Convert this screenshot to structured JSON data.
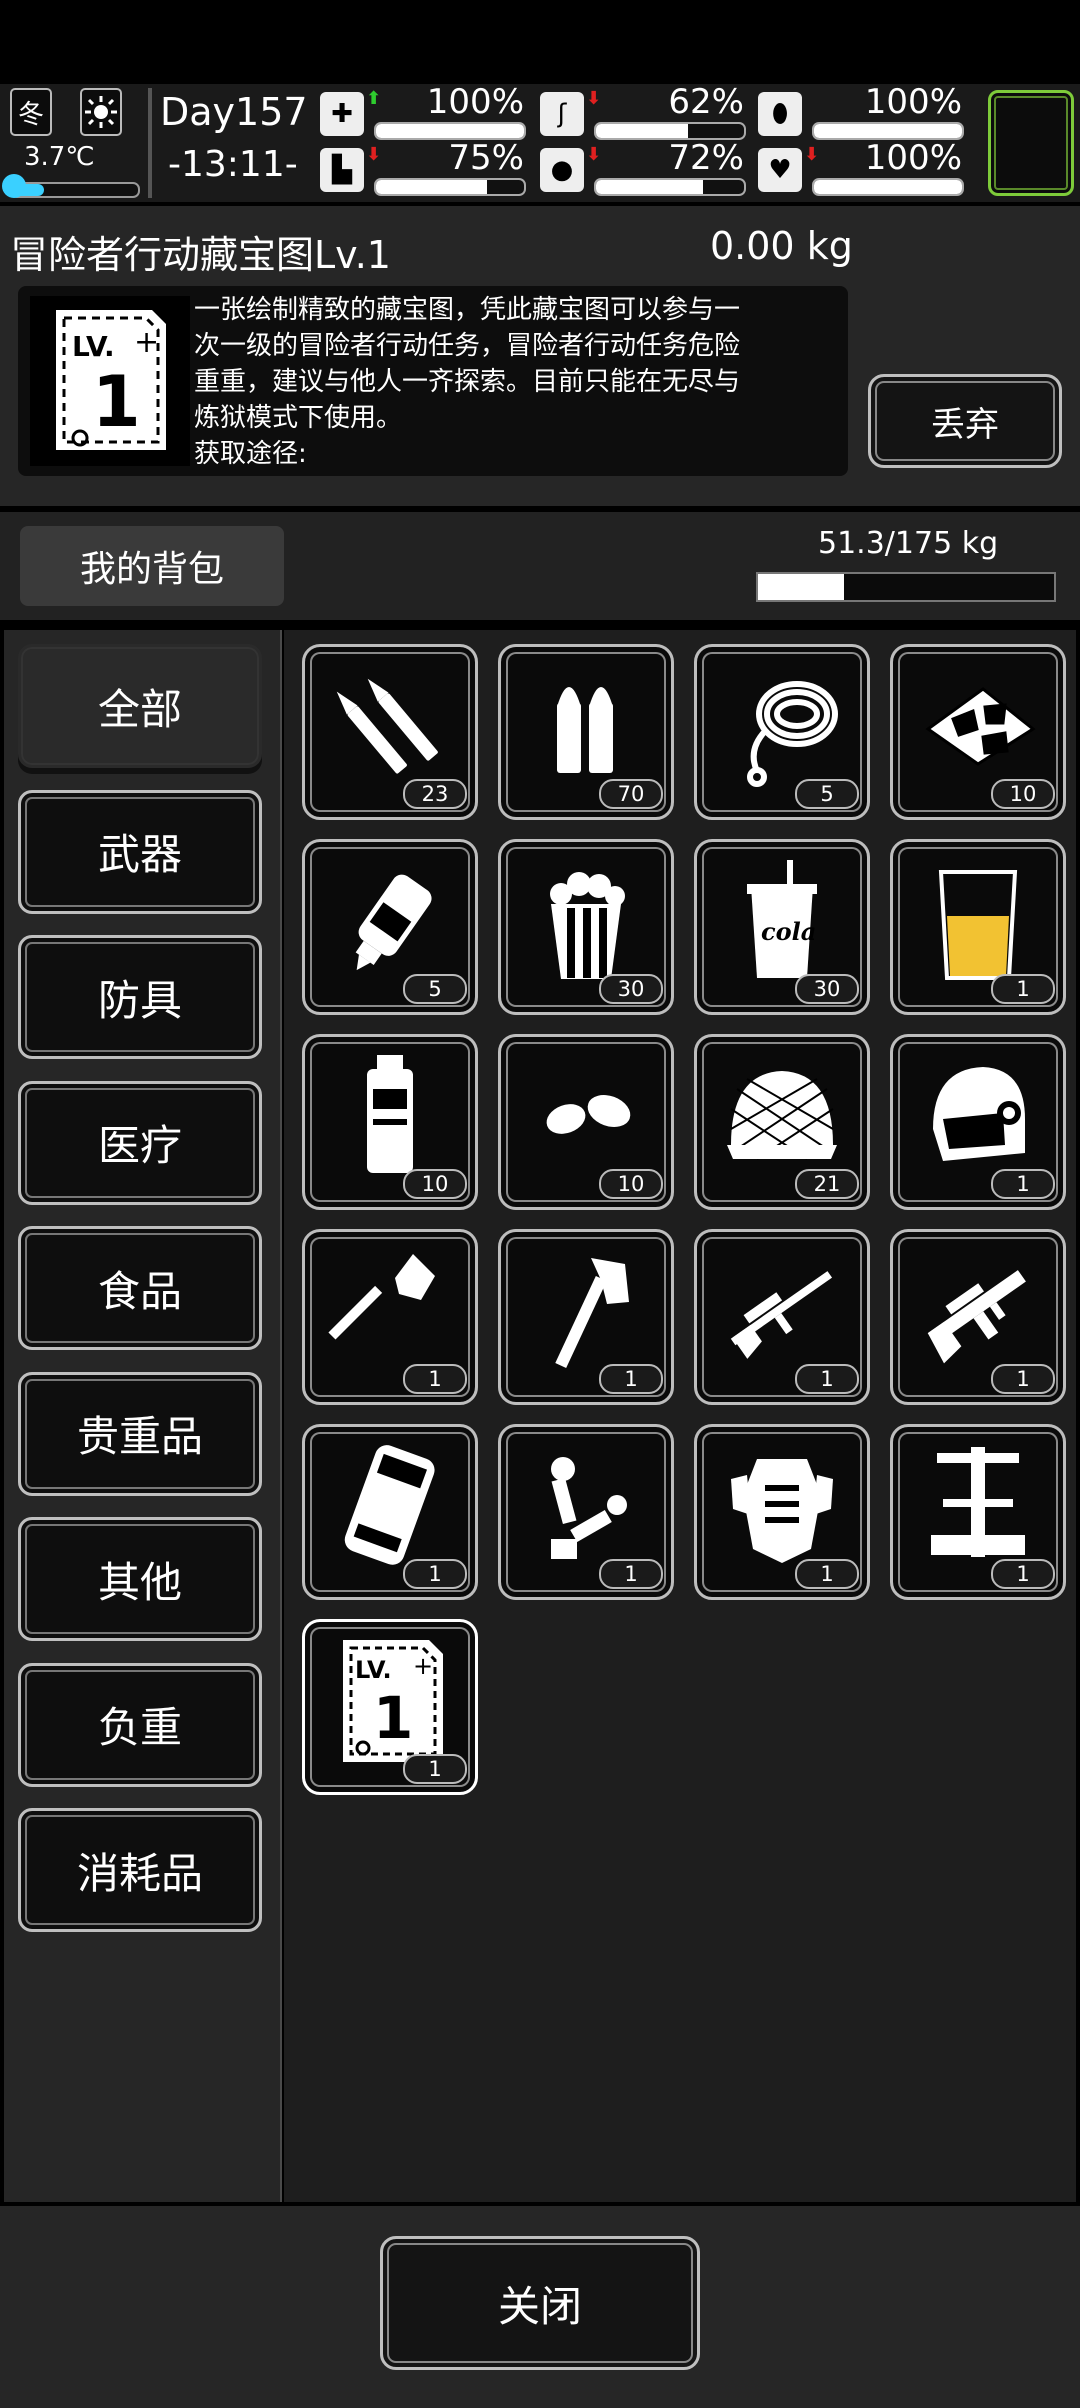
{
  "status": {
    "season": "冬",
    "weather_icon": "sun-icon",
    "temperature": "3.7℃",
    "temperature_level": 0.25,
    "day": "Day157",
    "time": "-13:11-",
    "stats": [
      {
        "name": "health",
        "icon": "medkit-icon",
        "trend": "up",
        "value": "100%",
        "level": 1.0
      },
      {
        "name": "hunger",
        "icon": "stomach-icon",
        "trend": "down",
        "value": "62%",
        "level": 0.62
      },
      {
        "name": "armor",
        "icon": "armor-icon",
        "trend": "none",
        "value": "100%",
        "level": 1.0
      },
      {
        "name": "stamina",
        "icon": "leg-icon",
        "trend": "down",
        "value": "75%",
        "level": 0.75
      },
      {
        "name": "thirst",
        "icon": "water-drop-icon",
        "trend": "down",
        "value": "72%",
        "level": 0.72
      },
      {
        "name": "mood",
        "icon": "heart-icon",
        "trend": "down",
        "value": "100%",
        "level": 1.0
      }
    ],
    "colors": {
      "up": "#2ecc2e",
      "down": "#e02020",
      "equip_border": "#7ecb3a"
    }
  },
  "item_detail": {
    "name": "冒险者行动藏宝图Lv.1",
    "weight": "0.00 kg",
    "icon_text_lv": "LV.",
    "icon_text_num": "1",
    "description_lines": [
      "一张绘制精致的藏宝图，凭此藏宝图可以参与一",
      "次一级的冒险者行动任务，冒险者行动任务危险",
      "重重，建议与他人一齐探索。目前只能在无尽与",
      "炼狱模式下使用。",
      "获取途径:"
    ],
    "discard_label": "丢弃"
  },
  "backpack": {
    "title": "我的背包",
    "weight": "51.3/175 kg",
    "load_fraction": 0.29
  },
  "categories": [
    "全部",
    "武器",
    "防具",
    "医疗",
    "食品",
    "贵重品",
    "其他",
    "负重",
    "消耗品"
  ],
  "items": [
    {
      "icon": "bullets-rifle-icon",
      "count": "23"
    },
    {
      "icon": "bullets-pistol-icon",
      "count": "70"
    },
    {
      "icon": "rope-icon",
      "count": "5"
    },
    {
      "icon": "cloth-scraps-icon",
      "count": "10"
    },
    {
      "icon": "glue-bottle-icon",
      "count": "5"
    },
    {
      "icon": "popcorn-icon",
      "count": "30"
    },
    {
      "icon": "cola-icon",
      "count": "30",
      "text": "cola"
    },
    {
      "icon": "juice-cup-icon",
      "count": "1"
    },
    {
      "icon": "sports-drink-icon",
      "count": "10"
    },
    {
      "icon": "seeds-icon",
      "count": "10"
    },
    {
      "icon": "camo-net-helmet-icon",
      "count": "21"
    },
    {
      "icon": "tactical-helmet-icon",
      "count": "1"
    },
    {
      "icon": "shovel-icon",
      "count": "1"
    },
    {
      "icon": "fire-axe-icon",
      "count": "1"
    },
    {
      "icon": "sniper-rifle-icon",
      "count": "1"
    },
    {
      "icon": "assault-rifle-icon",
      "count": "1"
    },
    {
      "icon": "vehicle-icon",
      "count": "1"
    },
    {
      "icon": "robot-arm-icon",
      "count": "1"
    },
    {
      "icon": "armor-rig-icon",
      "count": "1"
    },
    {
      "icon": "machine-part-icon",
      "count": "1"
    },
    {
      "icon": "treasure-map-lv1-icon",
      "count": "1",
      "text": "LV.",
      "num": "1"
    }
  ],
  "close_label": "关闭"
}
